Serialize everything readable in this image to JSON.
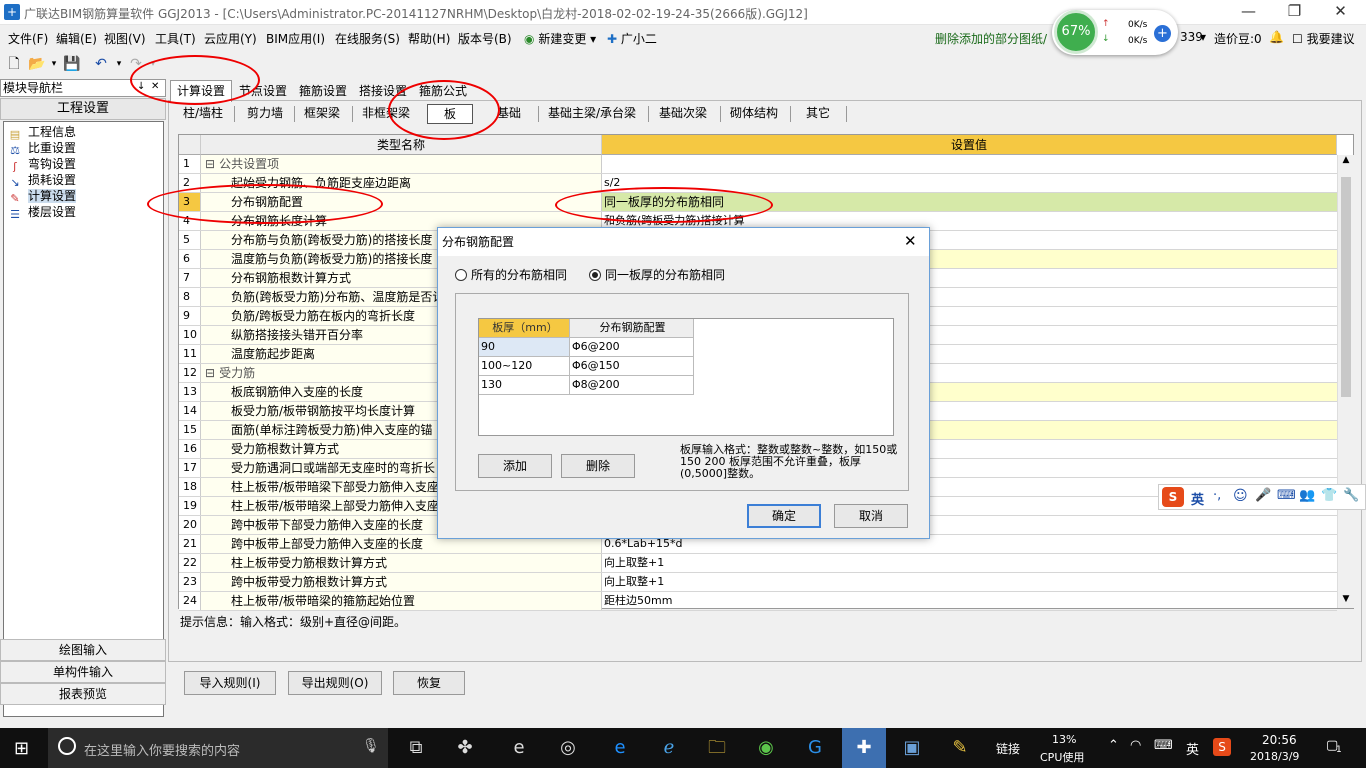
{
  "window": {
    "title": "广联达BIM钢筋算量软件 GGJ2013 - [C:\\Users\\Administrator.PC-20141127NRHM\\Desktop\\白龙村-2018-02-02-19-24-35(2666版).GGJ12]",
    "min": "—",
    "max": "❐",
    "close": "✕"
  },
  "menu": [
    "文件(F)",
    "编辑(E)",
    "视图(V)",
    "工具(T)",
    "云应用(Y)",
    "BIM应用(I)",
    "在线服务(S)",
    "帮助(H)",
    "版本号(B)",
    "新建变更",
    "广小二"
  ],
  "menu_right": {
    "notice": "删除添加的部分图纸/",
    "num": "339",
    "coins": "造价豆:0",
    "suggest": "我要建议"
  },
  "net": {
    "percent": "67%",
    "up": "0K/s",
    "down": "0K/s"
  },
  "nav": {
    "header": "模块导航栏",
    "pin": "↓",
    "close": "✕",
    "group": "工程设置",
    "items": [
      "工程信息",
      "比重设置",
      "弯钩设置",
      "损耗设置",
      "计算设置",
      "楼层设置"
    ],
    "bottom": [
      "绘图输入",
      "单构件输入",
      "报表预览"
    ]
  },
  "tabs1": [
    "计算设置",
    "节点设置",
    "箍筋设置",
    "搭接设置",
    "箍筋公式"
  ],
  "tabs2": [
    "柱/墙柱",
    "剪力墙",
    "框架梁",
    "非框架梁",
    "板",
    "基础",
    "基础主梁/承台梁",
    "基础次梁",
    "砌体结构",
    "其它"
  ],
  "grid": {
    "col_name": "类型名称",
    "col_value": "设置值",
    "rows": [
      {
        "n": "1",
        "name": "公共设置项",
        "v": "",
        "group": true
      },
      {
        "n": "2",
        "name": "起始受力钢筋、负筋距支座边距离",
        "v": "s/2"
      },
      {
        "n": "3",
        "name": "分布钢筋配置",
        "v": "同一板厚的分布筋相同",
        "sel": true
      },
      {
        "n": "4",
        "name": "分布钢筋长度计算",
        "v": "和负筋(跨板受力筋)搭接计算"
      },
      {
        "n": "5",
        "name": "分布筋与负筋(跨板受力筋)的搭接长度",
        "v": ""
      },
      {
        "n": "6",
        "name": "温度筋与负筋(跨板受力筋)的搭接长度",
        "v": "",
        "yellow": true
      },
      {
        "n": "7",
        "name": "分布钢筋根数计算方式",
        "v": ""
      },
      {
        "n": "8",
        "name": "负筋(跨板受力筋)分布筋、温度筋是否计",
        "v": ""
      },
      {
        "n": "9",
        "name": "负筋/跨板受力筋在板内的弯折长度",
        "v": ""
      },
      {
        "n": "10",
        "name": "纵筋搭接接头错开百分率",
        "v": ""
      },
      {
        "n": "11",
        "name": "温度筋起步距离",
        "v": ""
      },
      {
        "n": "12",
        "name": "受力筋",
        "v": "",
        "group": true
      },
      {
        "n": "13",
        "name": "板底钢筋伸入支座的长度",
        "v": "",
        "yellow": true
      },
      {
        "n": "14",
        "name": "板受力筋/板带钢筋按平均长度计算",
        "v": ""
      },
      {
        "n": "15",
        "name": "面筋(单标注跨板受力筋)伸入支座的锚",
        "v": "",
        "yellow": true
      },
      {
        "n": "16",
        "name": "受力筋根数计算方式",
        "v": ""
      },
      {
        "n": "17",
        "name": "受力筋遇洞口或端部无支座时的弯折长",
        "v": ""
      },
      {
        "n": "18",
        "name": "柱上板带/板带暗梁下部受力筋伸入支座",
        "v": ""
      },
      {
        "n": "19",
        "name": "柱上板带/板带暗梁上部受力筋伸入支座",
        "v": ""
      },
      {
        "n": "20",
        "name": "跨中板带下部受力筋伸入支座的长度",
        "v": ""
      },
      {
        "n": "21",
        "name": "跨中板带上部受力筋伸入支座的长度",
        "v": "0.6*Lab+15*d"
      },
      {
        "n": "22",
        "name": "柱上板带受力筋根数计算方式",
        "v": "向上取整+1"
      },
      {
        "n": "23",
        "name": "跨中板带受力筋根数计算方式",
        "v": "向上取整+1"
      },
      {
        "n": "24",
        "name": "柱上板带/板带暗梁的箍筋起始位置",
        "v": "距柱边50mm"
      }
    ]
  },
  "hint": "提示信息：输入格式：级别+直径@间距。",
  "bottom_buttons": [
    "导入规则(I)",
    "导出规则(O)",
    "恢复"
  ],
  "dialog": {
    "title": "分布钢筋配置",
    "close": "✕",
    "radio_all": "所有的分布筋相同",
    "radio_same": "同一板厚的分布筋相同",
    "col1": "板厚（mm）",
    "col2": "分布钢筋配置",
    "rows": [
      {
        "t": "90",
        "c": "Φ6@200"
      },
      {
        "t": "100~120",
        "c": "Φ6@150"
      },
      {
        "t": "130",
        "c": "Φ8@200"
      }
    ],
    "add": "添加",
    "delete": "删除",
    "note": "板厚输入格式：整数或整数~整数，如150或150 200 板厚范围不允许重叠，板厚(0,5000]整数。",
    "ok": "确定",
    "cancel": "取消"
  },
  "ime": {
    "lang": "英"
  },
  "taskbar": {
    "search": "在这里输入你要搜索的内容",
    "link": "链接",
    "cpu": "13%",
    "cpu_label": "CPU使用",
    "ime": "英",
    "time": "20:56",
    "date": "2018/3/9",
    "notify": "1"
  },
  "colors": {
    "header_yellow": "#f5c842",
    "selected_row": "#d6e9a8",
    "light_yellow": "#ffffcc",
    "red_mark": "#e00000"
  }
}
